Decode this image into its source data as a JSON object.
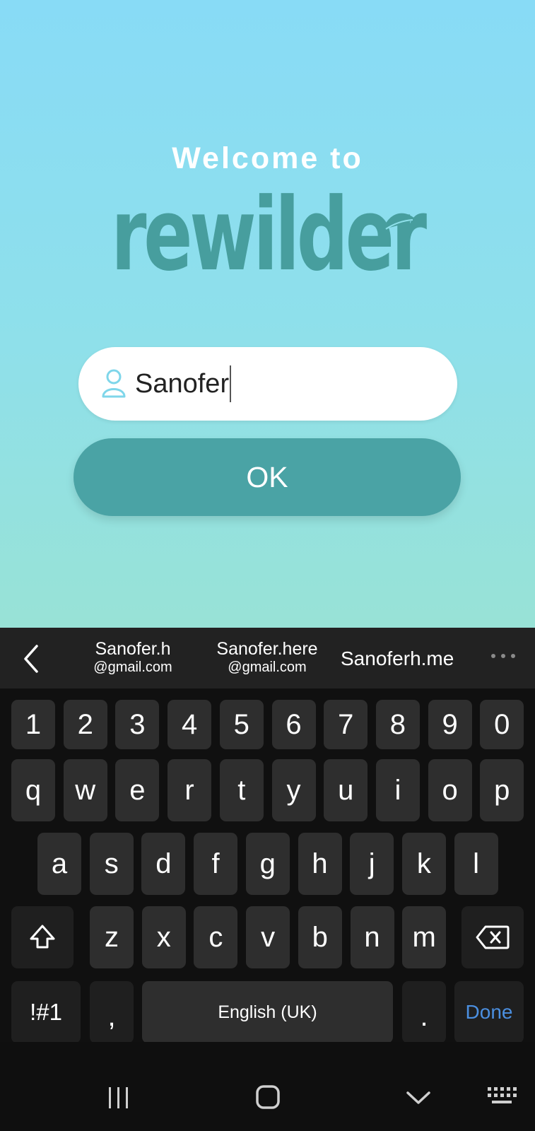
{
  "welcome_text": "Welcome to",
  "logo_text": "rewilder",
  "username_input": {
    "value": "Sanofer"
  },
  "ok_button": {
    "label": "OK"
  },
  "suggestions": [
    {
      "line1": "Sanofer.h",
      "line2": "@gmail.com"
    },
    {
      "line1": "Sanofer.here",
      "line2": "@gmail.com"
    },
    {
      "line1": "Sanoferh.me"
    }
  ],
  "keyboard": {
    "row_numbers": [
      "1",
      "2",
      "3",
      "4",
      "5",
      "6",
      "7",
      "8",
      "9",
      "0"
    ],
    "row_top": [
      "q",
      "w",
      "e",
      "r",
      "t",
      "y",
      "u",
      "i",
      "o",
      "p"
    ],
    "row_middle": [
      "a",
      "s",
      "d",
      "f",
      "g",
      "h",
      "j",
      "k",
      "l"
    ],
    "row_bottom": [
      "z",
      "x",
      "c",
      "v",
      "b",
      "n",
      "m"
    ],
    "symbols_key": "!#1",
    "comma_key": ",",
    "space_key": "English (UK)",
    "period_key": ".",
    "done_key": "Done"
  },
  "colors": {
    "brand_teal": "#479e9e",
    "button_teal": "#4aa3a5",
    "done_blue": "#4b8fe0"
  }
}
